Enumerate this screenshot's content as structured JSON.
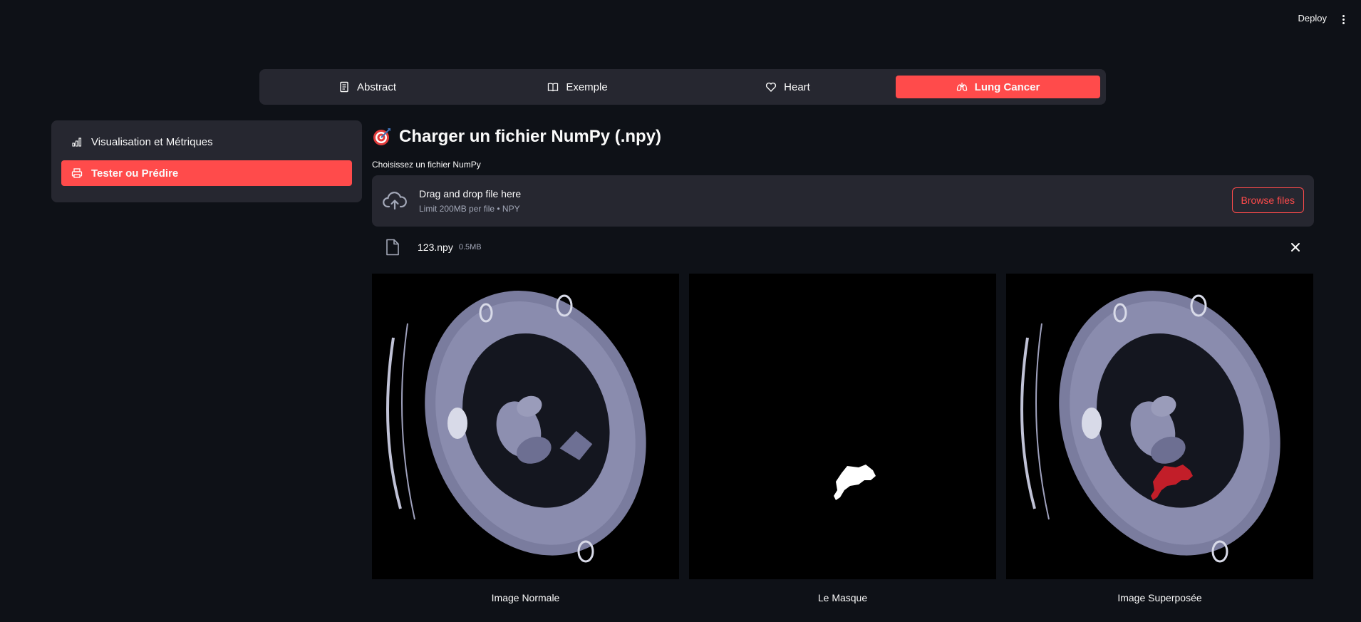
{
  "header": {
    "deploy_label": "Deploy",
    "menu_icon": "kebab-menu-icon"
  },
  "nav": {
    "tabs": [
      {
        "label": "Abstract",
        "icon": "document-icon",
        "active": false
      },
      {
        "label": "Exemple",
        "icon": "book-icon",
        "active": false
      },
      {
        "label": "Heart",
        "icon": "heart-icon",
        "active": false
      },
      {
        "label": "Lung Cancer",
        "icon": "lungs-icon",
        "active": true
      }
    ]
  },
  "sidebar": {
    "items": [
      {
        "label": "Visualisation et Métriques",
        "icon": "bar-chart-icon",
        "active": false
      },
      {
        "label": "Tester ou Prédire",
        "icon": "printer-icon",
        "active": true
      }
    ]
  },
  "main": {
    "title": "Charger un fichier NumPy (.npy)",
    "title_icon": "target-icon",
    "upload": {
      "label": "Choisissez un fichier NumPy",
      "drop_text": "Drag and drop file here",
      "limit_text": "Limit 200MB per file • NPY",
      "browse_label": "Browse files"
    },
    "file": {
      "name": "123.npy",
      "size": "0.5MB"
    },
    "images": [
      {
        "caption": "Image Normale"
      },
      {
        "caption": "Le Masque"
      },
      {
        "caption": "Image Superposée"
      }
    ]
  },
  "colors": {
    "accent": "#ff4b4b",
    "background": "#0e1117",
    "panel": "#262730"
  }
}
